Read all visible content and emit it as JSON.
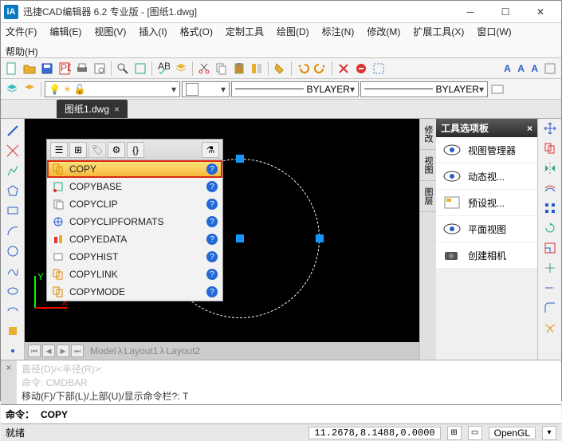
{
  "title": "迅捷CAD编辑器 6.2 专业版  - [图纸1.dwg]",
  "menu": [
    "文件(F)",
    "编辑(E)",
    "视图(V)",
    "插入(I)",
    "格式(O)",
    "定制工具",
    "绘图(D)",
    "标注(N)",
    "修改(M)",
    "扩展工具(X)",
    "窗口(W)",
    "帮助(H)"
  ],
  "toolbar2": {
    "linetype_label": "BYLAYER",
    "lineweight_label": "BYLAYER",
    "font_letters": "A A A"
  },
  "tab": {
    "name": "图纸1.dwg"
  },
  "autocomplete": {
    "items": [
      {
        "label": "COPY",
        "selected": true
      },
      {
        "label": "COPYBASE"
      },
      {
        "label": "COPYCLIP"
      },
      {
        "label": "COPYCLIPFORMATS"
      },
      {
        "label": "COPYEDATA"
      },
      {
        "label": "COPYHIST"
      },
      {
        "label": "COPYLINK"
      },
      {
        "label": "COPYMODE"
      }
    ]
  },
  "layout_tabs": [
    "Model",
    "Layout1",
    "Layout2"
  ],
  "palette": {
    "title": "工具选项板",
    "tabs": [
      "修改",
      "视图",
      "图层"
    ],
    "items": [
      "视图管理器",
      "动态视...",
      "预设视...",
      "平面视图",
      "创建相机"
    ]
  },
  "cmd_area": {
    "line1": "直径(D)/<半径(R)>:",
    "line2_prefix": "命令:   CMDBAR",
    "line3": "移动(F)/下部(L)/上部(U)/显示命令栏?: T",
    "prompt": "命令：",
    "value": "COPY"
  },
  "status": {
    "text": "就绪",
    "coords": "11.2678,8.1488,0.0000",
    "renderer": "OpenGL"
  }
}
